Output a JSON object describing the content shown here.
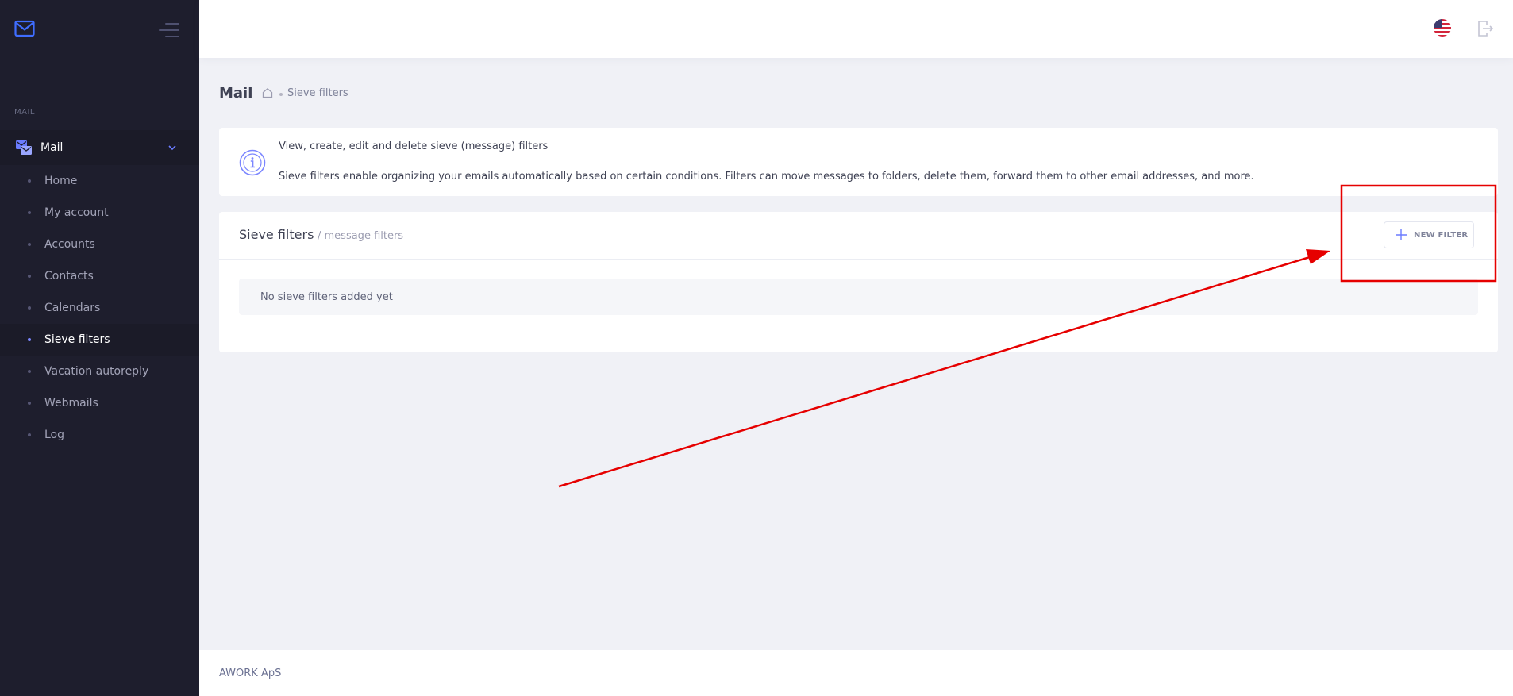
{
  "sidebar": {
    "section_label": "MAIL",
    "parent_label": "Mail",
    "items": [
      {
        "label": "Home"
      },
      {
        "label": "My account"
      },
      {
        "label": "Accounts"
      },
      {
        "label": "Contacts"
      },
      {
        "label": "Calendars"
      },
      {
        "label": "Sieve filters",
        "active": true
      },
      {
        "label": "Vacation autoreply"
      },
      {
        "label": "Webmails"
      },
      {
        "label": "Log"
      }
    ]
  },
  "subheader": {
    "title": "Mail",
    "breadcrumb_current": "Sieve filters"
  },
  "info": {
    "line1": "View, create, edit and delete sieve (message) filters",
    "line2": "Sieve filters enable organizing your emails automatically based on certain conditions. Filters can move messages to folders, delete them, forward them to other email addresses, and more."
  },
  "filters_card": {
    "title": "Sieve filters",
    "subtitle": "/ message filters",
    "new_button_label": "NEW FILTER",
    "empty_text": "No sieve filters added yet"
  },
  "footer": {
    "company": "AWORK ApS"
  },
  "colors": {
    "sidebar_bg": "#1e1e2d",
    "accent": "#7b86ff",
    "annotation_red": "#e60000"
  },
  "icons": {
    "logo": "envelope-icon",
    "toggle": "menu-toggle-icon",
    "parent": "mail-stack-icon",
    "language": "us-flag-icon",
    "logout": "logout-icon",
    "info": "info-circle-icon",
    "add": "plus-icon",
    "home": "home-icon"
  }
}
